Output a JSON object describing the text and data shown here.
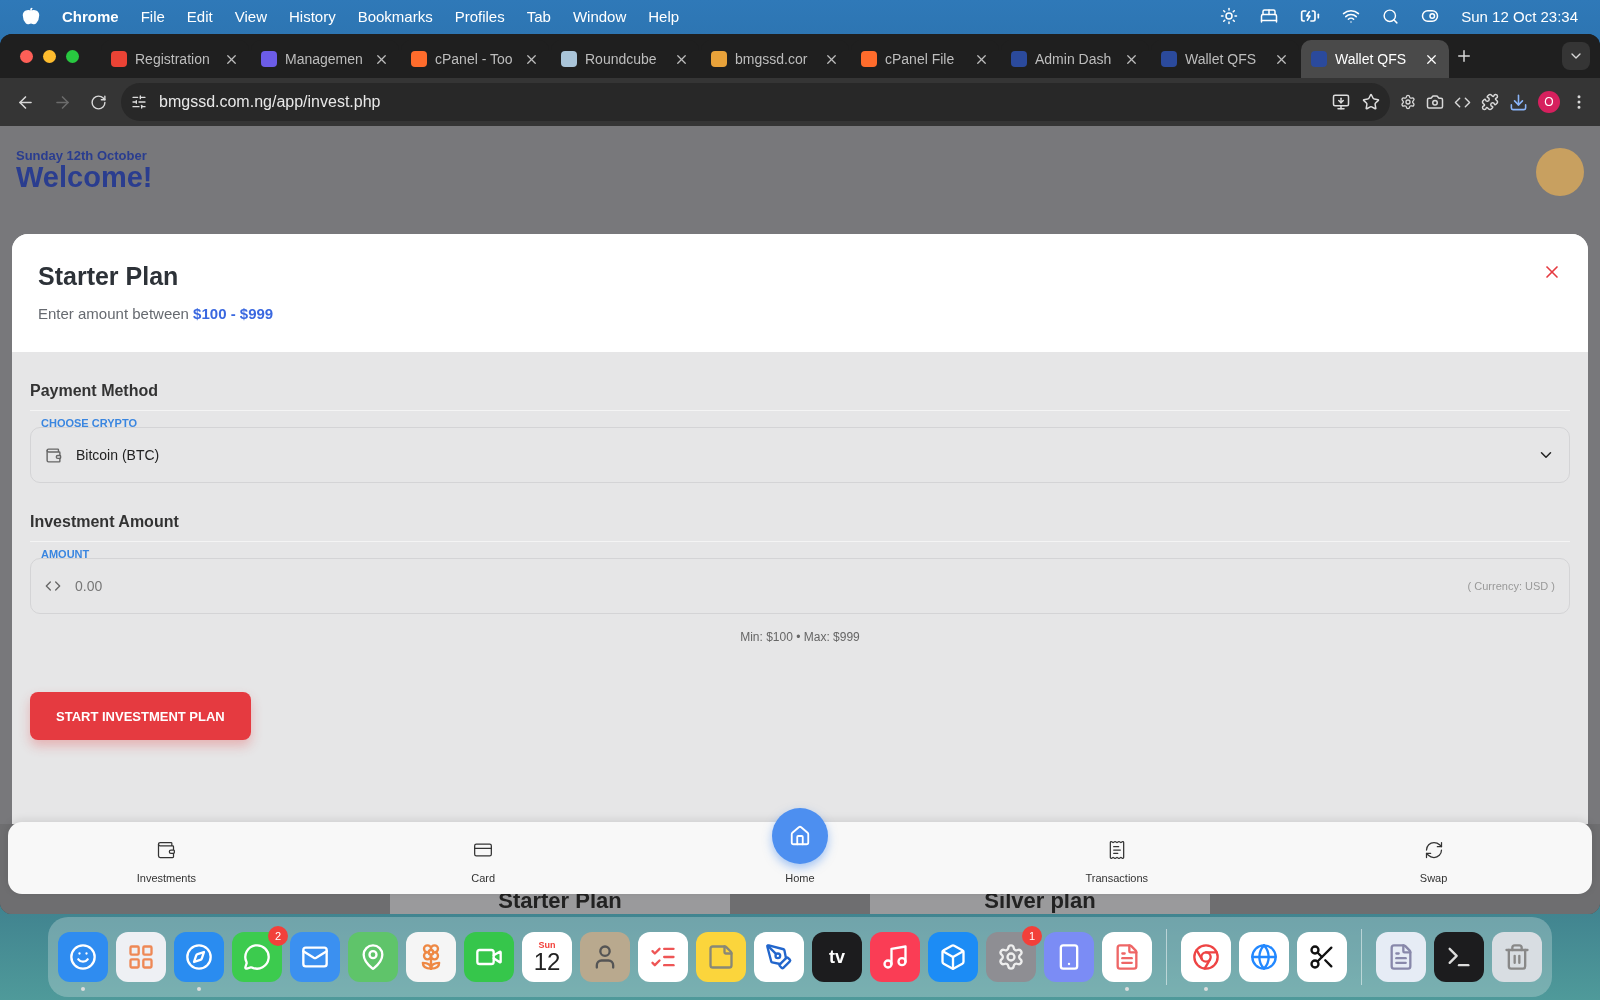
{
  "menu_bar": {
    "app": "Chrome",
    "menus": [
      "File",
      "Edit",
      "View",
      "History",
      "Bookmarks",
      "Profiles",
      "Tab",
      "Window",
      "Help"
    ],
    "clock": "Sun 12 Oct  23:34"
  },
  "tabs": [
    {
      "title": "Registration",
      "color": "#ea4335",
      "selected": false
    },
    {
      "title": "Managemen",
      "color": "#6c5ce7",
      "selected": false
    },
    {
      "title": "cPanel - Too",
      "color": "#ff6c2c",
      "selected": false
    },
    {
      "title": "Roundcube",
      "color": "#a9c4d8",
      "selected": false
    },
    {
      "title": "bmgssd.cor",
      "color": "#e8a23a",
      "selected": false
    },
    {
      "title": "cPanel File",
      "color": "#ff6c2c",
      "selected": false
    },
    {
      "title": "Admin Dash",
      "color": "#2b4a9c",
      "selected": false
    },
    {
      "title": "Wallet QFS",
      "color": "#2b4a9c",
      "selected": false
    },
    {
      "title": "Wallet QFS",
      "color": "#2b4a9c",
      "selected": true
    }
  ],
  "toolbar": {
    "back_disabled": false,
    "forward_disabled": true,
    "url": "bmgssd.com.ng/app/invest.php",
    "profile": "O"
  },
  "page": {
    "date": "Sunday 12th October",
    "greeting": "Welcome!"
  },
  "modal": {
    "title": "Starter Plan",
    "subtitle": "Enter amount between **$100 - $999**",
    "payment": {
      "heading": "Payment Method",
      "label": "CHOOSE CRYPTO",
      "value": "Bitcoin (BTC)"
    },
    "amount": {
      "heading": "Investment Amount",
      "label": "AMOUNT",
      "placeholder": "0.00",
      "suffix": "( Currency: USD )",
      "hint": "Min: $100 • Max: $999"
    },
    "submit": "START INVESTMENT PLAN"
  },
  "behind_cards": [
    "Starter Plan",
    "Silver plan"
  ],
  "bottom_nav": [
    {
      "kind": "wallet",
      "label": "Investments",
      "selected": false
    },
    {
      "kind": "card",
      "label": "Card",
      "selected": false
    },
    {
      "kind": "home",
      "label": "Home",
      "selected": true
    },
    {
      "kind": "list",
      "label": "Transactions",
      "selected": false
    },
    {
      "kind": "swap",
      "label": "Swap",
      "selected": false
    }
  ],
  "dock": [
    {
      "kind": "finder",
      "color": "#2f8cf0",
      "running": true
    },
    {
      "kind": "launchpad",
      "color": "#eef0f4",
      "running": false
    },
    {
      "kind": "safari",
      "color": "#2a8cf0",
      "running": true
    },
    {
      "kind": "messages",
      "color": "#3ccb4e",
      "running": false,
      "badge": "2"
    },
    {
      "kind": "mail",
      "color": "#3b90f0",
      "running": false
    },
    {
      "kind": "maps",
      "color": "#5fc46a",
      "running": false
    },
    {
      "kind": "photos",
      "color": "#f5f5f5",
      "running": false
    },
    {
      "kind": "facetime",
      "color": "#36c64b",
      "running": false
    },
    {
      "kind": "calendar",
      "color": "#ffffff",
      "running": false,
      "month": "Sun",
      "day": "12"
    },
    {
      "kind": "contacts",
      "color": "#b9a98e",
      "running": false
    },
    {
      "kind": "reminders",
      "color": "#ffffff",
      "running": false
    },
    {
      "kind": "notes",
      "color": "#fbd53c",
      "running": false
    },
    {
      "kind": "freeform",
      "color": "#ffffff",
      "running": false
    },
    {
      "kind": "tv",
      "color": "#1c1c1e",
      "running": false,
      "text": "tv"
    },
    {
      "kind": "music",
      "color": "#fa3d55",
      "running": false
    },
    {
      "kind": "appstore",
      "color": "#1c8cf5",
      "running": false
    },
    {
      "kind": "settings",
      "color": "#8e8e93",
      "running": false,
      "badge": "1"
    },
    {
      "kind": "device",
      "color": "#7b8cf5",
      "running": false
    },
    {
      "kind": "textedit",
      "color": "#ffffff",
      "running": true
    },
    {
      "kind": "separator"
    },
    {
      "kind": "chrome",
      "color": "#ffffff",
      "running": true
    },
    {
      "kind": "browser",
      "color": "#ffffff",
      "running": false
    },
    {
      "kind": "editor",
      "color": "#ffffff",
      "running": false
    },
    {
      "kind": "separator"
    },
    {
      "kind": "document",
      "color": "#e6ecf5",
      "running": false
    },
    {
      "kind": "terminal",
      "color": "#1c1c1e",
      "running": false
    },
    {
      "kind": "trash",
      "color": "#d8dde2",
      "running": false
    }
  ]
}
